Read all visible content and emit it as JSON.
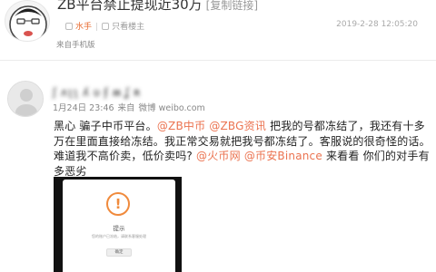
{
  "post": {
    "title": "ZB平台禁止提现近30万",
    "original_link": "[复制链接]",
    "author": "水手",
    "owner_only": "只看楼主",
    "date": "2019-2-28 12:05:20",
    "source": "来自手机版"
  },
  "weibo": {
    "username": "ʃ ʌʅʅ ʎ ʋ ʄ ʍ ʆ ʀ",
    "time": "1月24日 23:46",
    "from_label": "来自",
    "client": "微博 weibo.com",
    "body_segments": [
      {
        "text": "黑心 骗子中币平台。",
        "mention": false
      },
      {
        "text": "@ZB中币",
        "mention": true
      },
      {
        "text": " ",
        "mention": false
      },
      {
        "text": "@ZBG资讯",
        "mention": true
      },
      {
        "text": " 把我的号都冻结了，我还有十多万在里面直接给冻结。我正常交易就把我号都冻结了。客服说的很奇怪的话。难道我不高价卖，低价卖吗? ",
        "mention": false
      },
      {
        "text": "@火币网",
        "mention": true
      },
      {
        "text": " ",
        "mention": false
      },
      {
        "text": "@币安Binance",
        "mention": true
      },
      {
        "text": " 来看看  你们的对手有多恶劣",
        "mention": false
      }
    ],
    "screenshot": {
      "dialog_title": "提示",
      "dialog_text": "您的账户已冻结，请联系客服处理",
      "dialog_button": "确定",
      "icon_glyph": "!"
    }
  },
  "colors": {
    "mention": "#eb7350",
    "author": "#e86a2e",
    "warning": "#f08a3c"
  }
}
